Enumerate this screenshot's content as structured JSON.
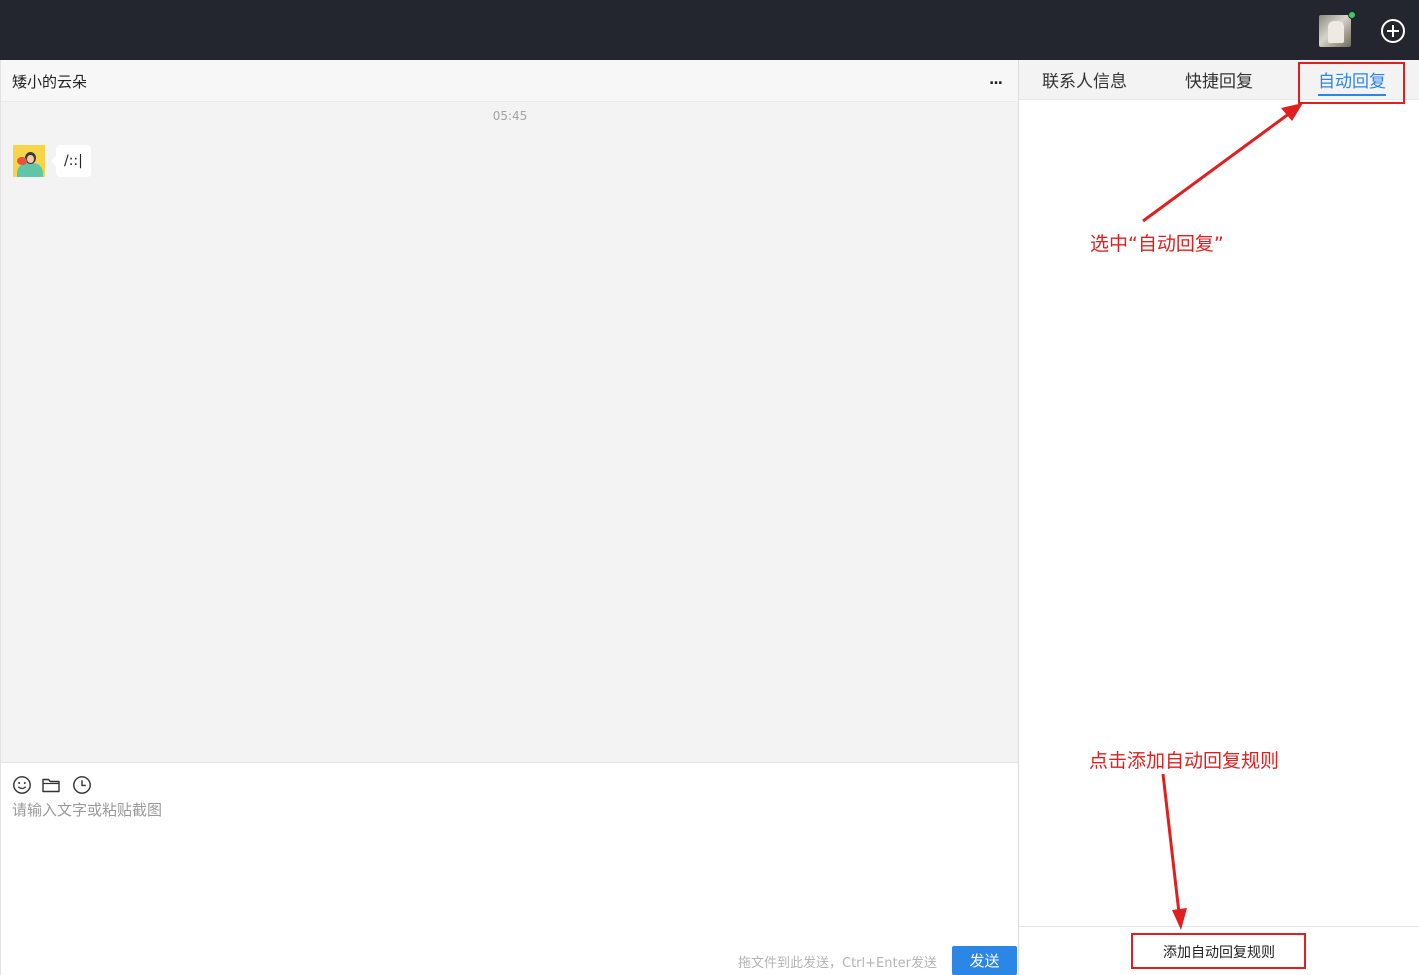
{
  "topbar": {
    "avatar_icon": "user-avatar",
    "status": "online",
    "add_icon": "plus-circle-icon"
  },
  "chat": {
    "title": "矮小的云朵",
    "more_label": "...",
    "timestamp": "05:45",
    "messages": [
      {
        "sender": "contact",
        "text": "/::|"
      }
    ]
  },
  "composer": {
    "tools": [
      "emoji-icon",
      "folder-icon",
      "clock-icon"
    ],
    "placeholder": "请输入文字或粘贴截图",
    "hint": "拖文件到此发送，Ctrl+Enter发送",
    "send_label": "发送"
  },
  "panel": {
    "tabs": [
      {
        "label": "联系人信息",
        "active": false
      },
      {
        "label": "快捷回复",
        "active": false
      },
      {
        "label": "自动回复",
        "active": true
      }
    ],
    "add_rule_label": "添加自动回复规则"
  },
  "annotations": {
    "select_tab": "选中“自动回复”",
    "click_add": "点击添加自动回复规则"
  },
  "colors": {
    "topbar": "#23252f",
    "accent": "#2b86e6",
    "annotation": "#e21f1f",
    "online": "#3ccb5c"
  }
}
